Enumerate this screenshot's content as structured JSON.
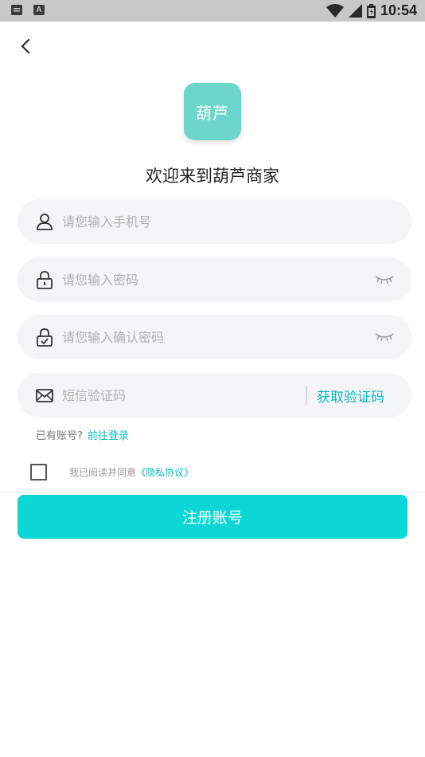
{
  "status_bar": {
    "left_icons": [
      "message-icon",
      "a-icon"
    ],
    "left_icon_a_letter": "A",
    "right_icons": [
      "wifi-icon",
      "signal-icon",
      "battery-icon"
    ],
    "time": "10:54"
  },
  "nav": {
    "back_icon": "chevron-left-icon"
  },
  "logo": {
    "text": "葫芦",
    "color": "#6dd6cc"
  },
  "welcome_title": "欢迎来到葫芦商家",
  "form": {
    "phone": {
      "placeholder": "请您输入手机号",
      "icon": "user-icon",
      "value": ""
    },
    "password": {
      "placeholder": "请您输入密码",
      "icon": "lock-icon",
      "value": "",
      "toggle_icon": "eye-closed-icon"
    },
    "confirm_password": {
      "placeholder": "请您输入确认密码",
      "icon": "lock-check-icon",
      "value": "",
      "toggle_icon": "eye-closed-icon"
    },
    "sms_code": {
      "placeholder": "短信验证码",
      "icon": "mail-icon",
      "value": "",
      "get_code_label": "获取验证码"
    }
  },
  "login_prompt": {
    "text": "已有账号?",
    "link": "前往登录"
  },
  "agreement": {
    "checked": false,
    "text": "我已阅读并同意",
    "policy_link": "《隐私协议》"
  },
  "register_button": {
    "label": "注册账号",
    "color": "#0dd6d6"
  },
  "accent_color": "#12b8c0"
}
